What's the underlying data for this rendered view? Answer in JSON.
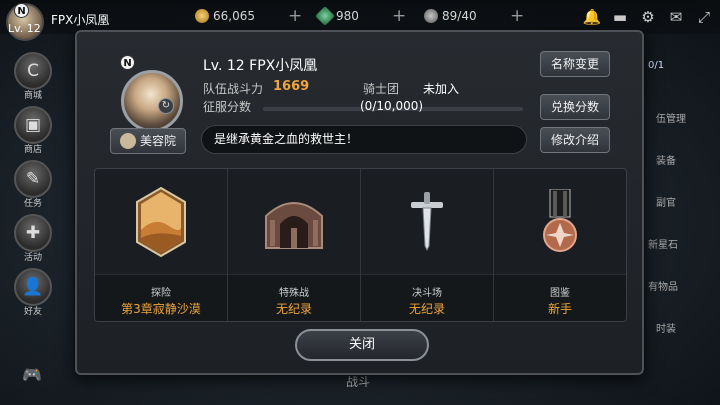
{
  "topbar": {
    "level": "Lv. 12",
    "player_name": "FPX小凤凰",
    "gold": "66,065",
    "gems": "980",
    "stamina": "89/40"
  },
  "sidebar": {
    "items": [
      {
        "label": "商城",
        "icon": "shop-c-icon"
      },
      {
        "label": "商店",
        "icon": "chest-icon"
      },
      {
        "label": "任务",
        "icon": "quest-icon"
      },
      {
        "label": "活动",
        "icon": "gift-icon"
      },
      {
        "label": "好友",
        "icon": "add-friend-icon"
      }
    ]
  },
  "background": {
    "bottom_text": "战斗",
    "right_counter": "0/1",
    "right_labels": [
      "伍管理",
      "装备",
      "副官",
      "新星石",
      "有物品",
      "时装"
    ]
  },
  "profile": {
    "title": "Lv. 12 FPX小凤凰",
    "power_label": "队伍战斗力",
    "power_value": "1669",
    "guild_label": "骑士团",
    "guild_value": "未加入",
    "conquest_label": "征服分数",
    "conquest_value": "(0/10,000)",
    "conquest_progress": 0,
    "motto": "是继承黄金之血的救世主！"
  },
  "buttons": {
    "rename": "名称变更",
    "exchange": "兑换分数",
    "edit_intro": "修改介绍",
    "beauty": "美容院",
    "close": "关闭"
  },
  "cards": [
    {
      "label": "探险",
      "value": "第3章寂静沙漠",
      "icon": "desert-icon"
    },
    {
      "label": "特殊战",
      "value": "无纪录",
      "icon": "ruins-icon"
    },
    {
      "label": "决斗场",
      "value": "无纪录",
      "icon": "sword-icon"
    },
    {
      "label": "图鉴",
      "value": "新手",
      "icon": "medal-icon"
    }
  ],
  "colors": {
    "accent": "#f0a53a",
    "panel": "#22262b"
  }
}
